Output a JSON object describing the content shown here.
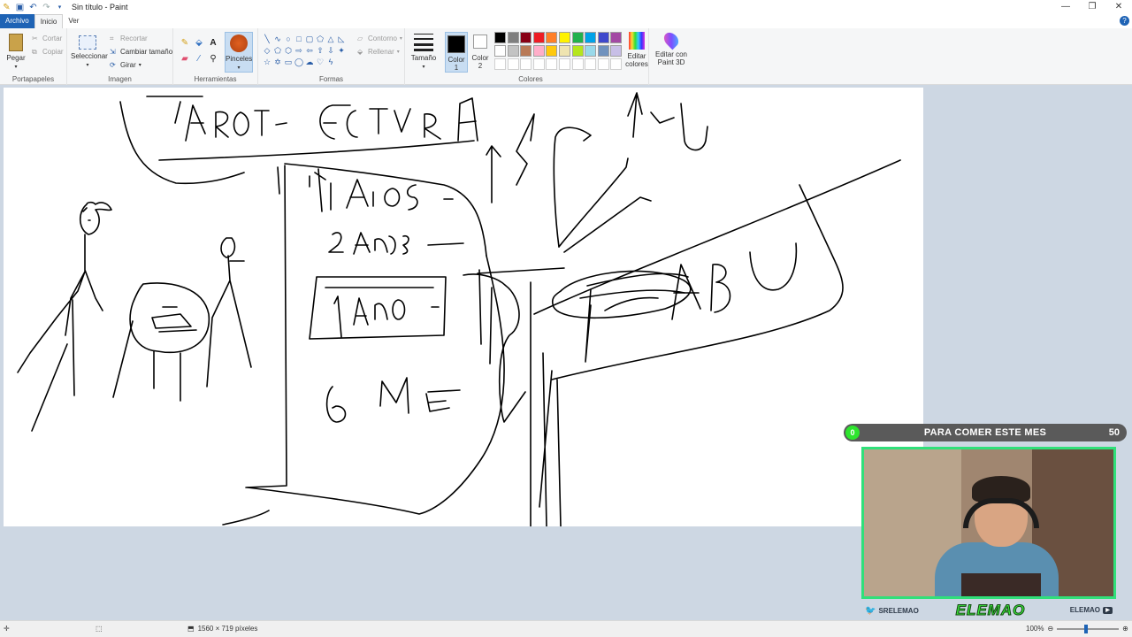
{
  "window": {
    "title": "Sin título - Paint",
    "controls": [
      "minimize",
      "maximize",
      "close"
    ]
  },
  "quick_access": [
    "paint-icon",
    "save-icon",
    "undo-icon",
    "redo-icon",
    "customize-icon"
  ],
  "tabs": [
    {
      "label": "Archivo"
    },
    {
      "label": "Inicio"
    },
    {
      "label": "Ver"
    }
  ],
  "ribbon": {
    "clipboard": {
      "group_label": "Portapapeles",
      "paste": "Pegar",
      "cut": "Cortar",
      "copy": "Copiar"
    },
    "image": {
      "group_label": "Imagen",
      "select": "Seleccionar",
      "crop": "Recortar",
      "resize": "Cambiar tamaño",
      "rotate": "Girar"
    },
    "tools": {
      "group_label": "Herramientas",
      "brushes": "Pinceles"
    },
    "shapes": {
      "group_label": "Formas",
      "outline": "Contorno",
      "fill": "Rellenar"
    },
    "size": {
      "label": "Tamaño"
    },
    "colors": {
      "group_label": "Colores",
      "color1": "Color 1",
      "color2": "Color 2",
      "edit_colors": "Editar colores",
      "edit_3d": "Editar con Paint 3D",
      "color1_value": "#000000",
      "color2_value": "#ffffff",
      "palette": [
        "#000000",
        "#7f7f7f",
        "#880015",
        "#ed1c24",
        "#ff7f27",
        "#fff200",
        "#22b14c",
        "#00a2e8",
        "#3f48cc",
        "#a349a4",
        "#ffffff",
        "#c3c3c3",
        "#b97a57",
        "#ffaec9",
        "#ffc90e",
        "#efe4b0",
        "#b5e61d",
        "#99d9ea",
        "#7092be",
        "#c8bfe7"
      ]
    }
  },
  "status": {
    "dimensions": "1560 × 719 píxeles",
    "zoom": "100%"
  },
  "overlay": {
    "goal_count": "0",
    "goal_text": "PARA COMER ESTE MES",
    "goal_target": "50",
    "twitter_handle": "SRELEMAO",
    "logo_text": "ELEMAO",
    "youtube_handle": "ELEMAO"
  }
}
